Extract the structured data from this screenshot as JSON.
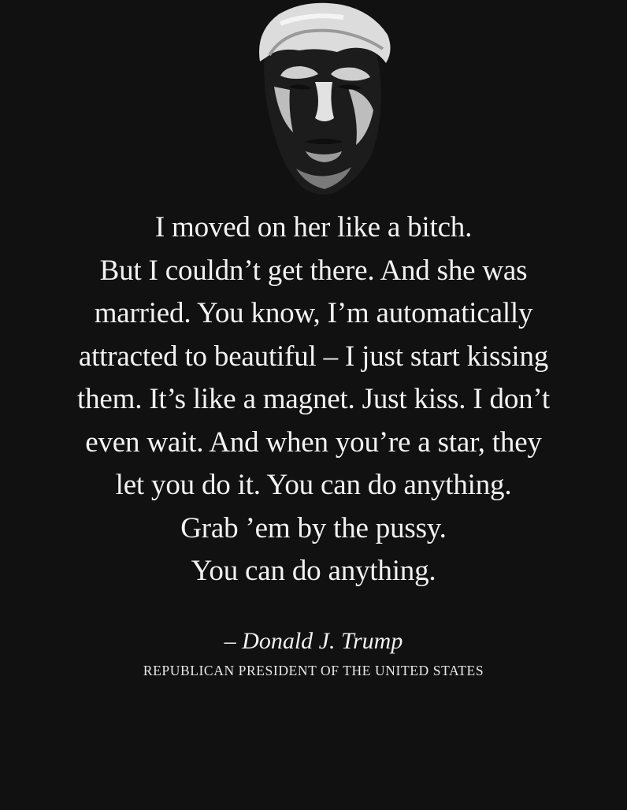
{
  "colors": {
    "background": "#111111",
    "text": "#f2f2f2"
  },
  "image": {
    "icon": "portrait-illustration"
  },
  "quote": {
    "lines": [
      "I moved on her like a bitch.",
      "But I couldn’t get there. And she was",
      "married. You know, I’m automatically",
      "attracted to beautiful – I just start kissing",
      "them. It’s like a magnet. Just kiss. I don’t",
      "even wait. And when you’re a star, they",
      "let you do it. You can do anything.",
      "Grab ’em by the pussy.",
      "You can do anything."
    ]
  },
  "attribution": {
    "name": "– Donald J. Trump",
    "title": "REPUBLICAN PRESIDENT OF THE UNITED STATES"
  }
}
